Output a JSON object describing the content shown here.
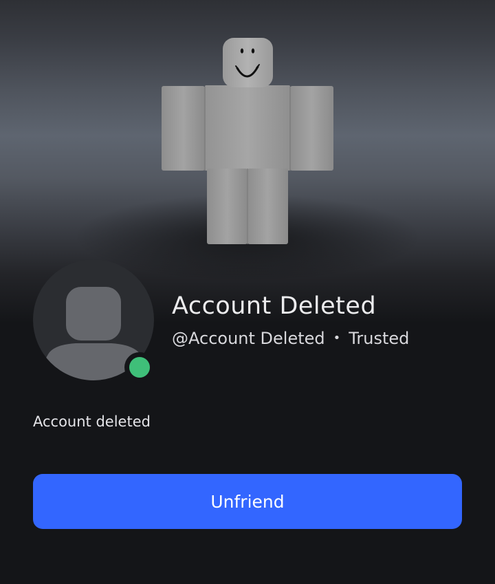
{
  "profile": {
    "display_name": "Account Deleted",
    "username": "@Account Deleted",
    "separator": "•",
    "status_tag": "Trusted",
    "about": "Account deleted",
    "presence": "online"
  },
  "actions": {
    "unfriend_label": "Unfriend"
  },
  "colors": {
    "accent": "#3366ff",
    "presence_online": "#3fbf79",
    "background": "#141518"
  }
}
